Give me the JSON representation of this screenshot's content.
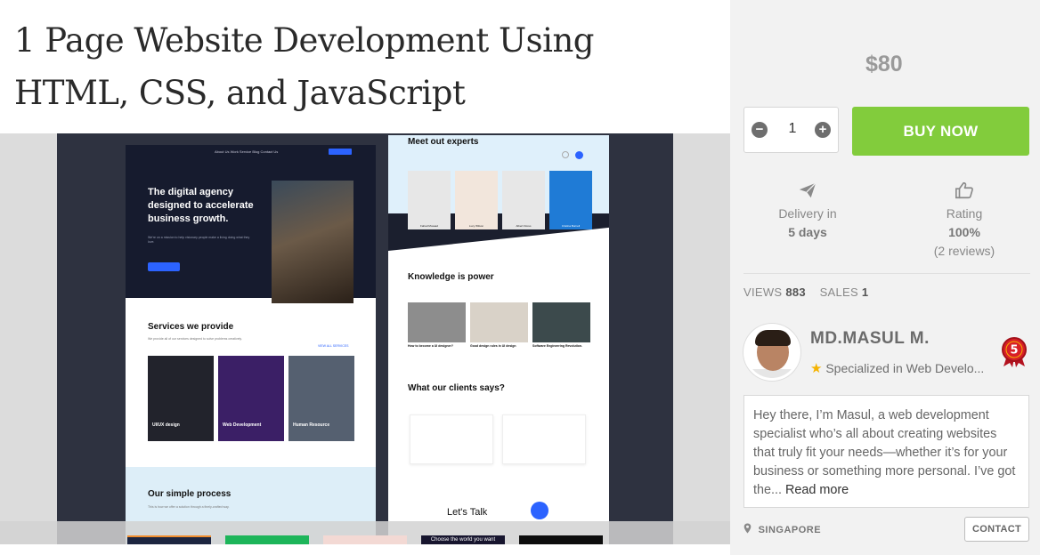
{
  "gig": {
    "title": "1 Page Website Development Using HTML, CSS, and JavaScript"
  },
  "preview": {
    "siteA": {
      "nav": "About Us   Work   Service   Blog   Contact Us",
      "hero_title": "The digital agency designed to accelerate business growth.",
      "services_title": "Services we provide",
      "view_all": "VIEW ALL SERVICES",
      "cards": [
        "UI/UX design",
        "Web Development",
        "Human Resource"
      ],
      "process_title": "Our simple process"
    },
    "siteB": {
      "team_title": "Meet out experts",
      "members": [
        "Fahad Mosaad",
        "Lucy Wilson",
        "Albert Flores",
        "Cristina Burnell"
      ],
      "knowledge_title": "Knowledge is power",
      "articles": [
        "How to become a UI designer?",
        "Good design rules in UI design",
        "Software Engineering Revolution."
      ],
      "clients_title": "What our clients says?",
      "talk": "Let's Talk"
    },
    "thumb_caption": "Choose the world you want"
  },
  "purchase": {
    "price": "$80",
    "quantity": "1",
    "minus": "−",
    "plus": "+",
    "buy_label": "BUY NOW"
  },
  "meta": {
    "delivery_label": "Delivery in",
    "delivery_value": "5 days",
    "rating_label": "Rating",
    "rating_value": "100%",
    "rating_reviews": "(2 reviews)"
  },
  "stats": {
    "views_label": "VIEWS",
    "views_value": "883",
    "sales_label": "SALES",
    "sales_value": "1"
  },
  "seller": {
    "name": "MD.MASUL M.",
    "specialization": "Specialized in Web Develo...",
    "level_badge": "5",
    "bio": "Hey there, I’m Masul, a web development specialist who’s all about creating websites that truly fit your needs—whether it’s for your business or something more personal. I’ve got the...",
    "read_more": "Read more",
    "location": "SINGAPORE",
    "contact_label": "CONTACT"
  },
  "colors": {
    "buy_button": "#82cc3c",
    "price": "#9a9a9a",
    "preview_bg": "#2e3240",
    "accent_blue": "#2c63ff"
  }
}
